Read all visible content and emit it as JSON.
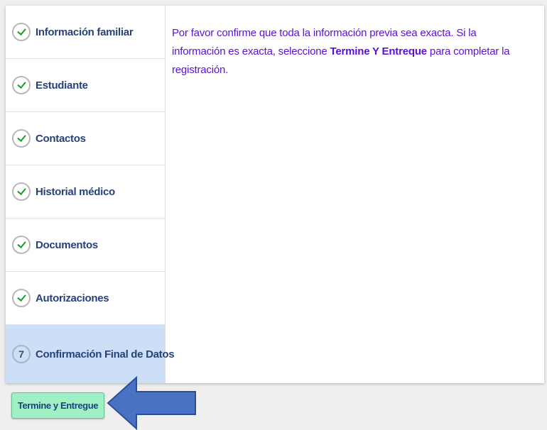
{
  "steps": [
    {
      "label": "Información familiar",
      "status": "complete"
    },
    {
      "label": "Estudiante",
      "status": "complete"
    },
    {
      "label": "Contactos",
      "status": "complete"
    },
    {
      "label": "Historial médico",
      "status": "complete"
    },
    {
      "label": "Documentos",
      "status": "complete"
    },
    {
      "label": "Autorizaciones",
      "status": "complete"
    },
    {
      "label": "Confirmación Final de Datos",
      "status": "active",
      "number": "7"
    }
  ],
  "content": {
    "part1": "Por favor confirme que toda la información previa sea exacta. Si la información es exacta, seleccione ",
    "highlight": "Termine Y Entreque",
    "part2": " para completar la registración."
  },
  "submit_label": "Termine y Entregue",
  "colors": {
    "accent_text": "#5a10d8",
    "step_label": "#27427a",
    "active_step_bg": "#cddff6",
    "check": "#1e9b2a",
    "button_bg": "#9ff0c4",
    "arrow": "#4a72c4"
  },
  "icons": {
    "complete": "check-icon",
    "pointer": "arrow-left-icon"
  }
}
